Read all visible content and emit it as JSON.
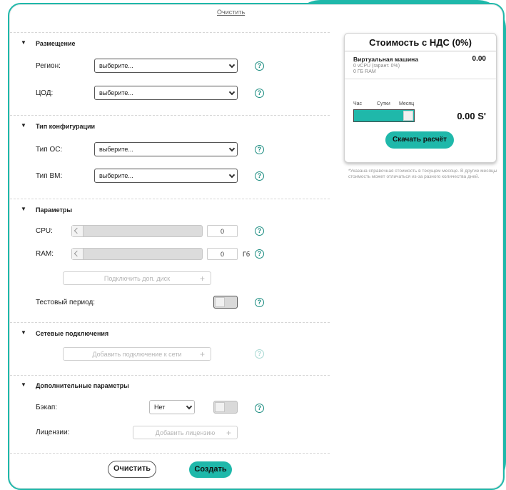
{
  "colors": {
    "accent": "#1fb8aa",
    "help_icon": "#1a8c80"
  },
  "top": {
    "clear_link": "Очистить"
  },
  "sections": {
    "placement": {
      "title": "Размещение",
      "region_label": "Регион:",
      "region_value": "выберите...",
      "dc_label": "ЦОД:",
      "dc_value": "выберите..."
    },
    "config": {
      "title": "Тип конфигурации",
      "os_label": "Тип ОС:",
      "os_value": "выберите...",
      "vm_label": "Тип ВМ:",
      "vm_value": "выберите..."
    },
    "params": {
      "title": "Параметры",
      "cpu_label": "CPU:",
      "cpu_value": "0",
      "ram_label": "RAM:",
      "ram_value": "0",
      "ram_unit": "Гб",
      "add_disk": "Подключить доп. диск",
      "trial_label": "Тестовый период:"
    },
    "network": {
      "title": "Сетевые подключения",
      "add_network": "Добавить подключение к сети"
    },
    "extra": {
      "title": "Дополнительные параметры",
      "backup_label": "Бэкап:",
      "backup_value": "Нет",
      "license_label": "Лицензии:",
      "add_license": "Добавить лицензию"
    }
  },
  "help_symbol": "?",
  "plus_symbol": "+",
  "buttons": {
    "clear": "Очистить",
    "create": "Создать"
  },
  "cost": {
    "title": "Стоимость с НДС (0%)",
    "vm_name": "Виртуальная машина",
    "vm_price": "0.00",
    "vm_cpu": "0 vCPU (гарант. 0%)",
    "vm_ram": "0 ГБ RAM",
    "period_hour": "Час",
    "period_day": "Сутки",
    "period_month": "Месяц",
    "period_level": 1.0,
    "total": "0.00 S'",
    "download": "Скачать расчёт"
  },
  "note": "*Указана справочная стоимость в текущем месяце. В другие месяцы стоимость может отличаться из-за разного количества дней."
}
